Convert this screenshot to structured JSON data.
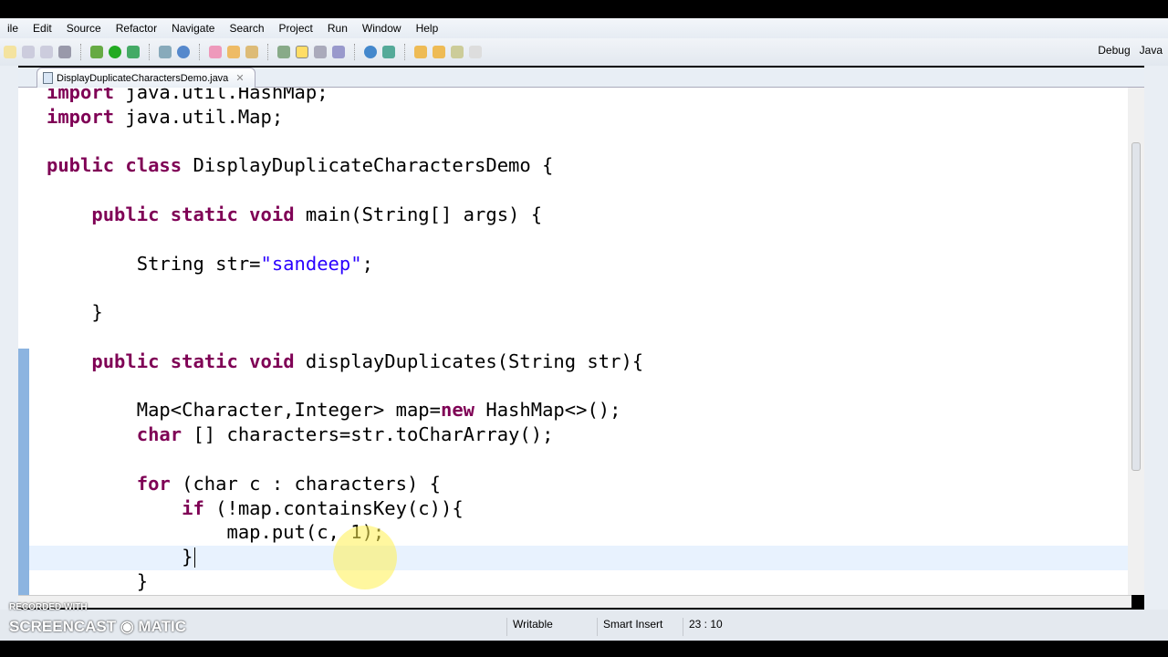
{
  "menu": [
    "ile",
    "Edit",
    "Source",
    "Refactor",
    "Navigate",
    "Search",
    "Project",
    "Run",
    "Window",
    "Help"
  ],
  "perspectives": {
    "debug": "Debug",
    "java": "Java"
  },
  "tab": {
    "title": "DisplayDuplicateCharactersDemo.java",
    "close": "✕"
  },
  "code": [
    [
      [
        "kw",
        "import"
      ],
      [
        "",
        "java.util.HashMap;"
      ]
    ],
    [
      [
        "kw",
        "import"
      ],
      [
        "",
        "java.util.Map;"
      ]
    ],
    [],
    [
      [
        "kw",
        "public class"
      ],
      [
        "",
        "DisplayDuplicateCharactersDemo {"
      ]
    ],
    [],
    [
      [
        "",
        "    "
      ],
      [
        "kw",
        "public static void"
      ],
      [
        "",
        "main(String[] args) {"
      ]
    ],
    [],
    [
      [
        "",
        "        String str="
      ],
      [
        "str",
        "\"sandeep\""
      ],
      [
        "",
        ";"
      ]
    ],
    [],
    [
      [
        "",
        "    }"
      ]
    ],
    [],
    [
      [
        "",
        "    "
      ],
      [
        "kw",
        "public static void"
      ],
      [
        "",
        "displayDuplicates(String str){"
      ]
    ],
    [],
    [
      [
        "",
        "        Map<Character,Integer> map="
      ],
      [
        "kw",
        "new"
      ],
      [
        "",
        "HashMap<>();"
      ]
    ],
    [
      [
        "",
        "        "
      ],
      [
        "kw",
        "char"
      ],
      [
        "",
        "[] characters=str.toCharArray();"
      ]
    ],
    [],
    [
      [
        "",
        "        "
      ],
      [
        "kw",
        "for"
      ],
      [
        "",
        "(char c : characters) {"
      ]
    ],
    [
      [
        "",
        "            "
      ],
      [
        "kw",
        "if"
      ],
      [
        "",
        "(!map.containsKey(c)){"
      ]
    ],
    [
      [
        "",
        "                map.put(c, 1);"
      ]
    ],
    [
      [
        "",
        "            }"
      ]
    ],
    [
      [
        "",
        "        }"
      ]
    ]
  ],
  "status": {
    "mode": "Writable",
    "insert": "Smart Insert",
    "position": "23 : 10"
  },
  "watermark": {
    "line1": "RECORDED WITH",
    "line2": "SCREENCAST ◉ MATIC"
  }
}
